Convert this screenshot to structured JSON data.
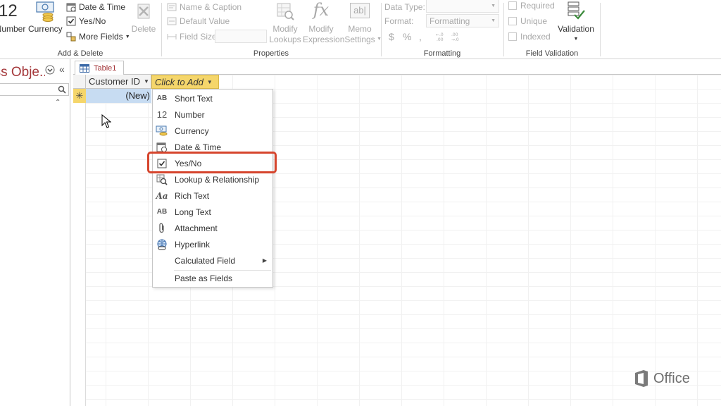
{
  "ribbon": {
    "add_delete": {
      "group_label": "Add & Delete",
      "number_glyph": "12",
      "number_label": "Number",
      "currency_label": "Currency",
      "date_time_label": "Date & Time",
      "yes_no_label": "Yes/No",
      "more_fields_label": "More Fields",
      "delete_label": "Delete"
    },
    "properties": {
      "group_label": "Properties",
      "name_caption_label": "Name & Caption",
      "default_value_label": "Default Value",
      "field_size_label": "Field Size",
      "modify_lookups_label_1": "Modify",
      "modify_lookups_label_2": "Lookups",
      "modify_expression_label_1": "Modify",
      "modify_expression_label_2": "Expression",
      "memo_settings_label_1": "Memo",
      "memo_settings_label_2": "Settings"
    },
    "formatting": {
      "group_label": "Formatting",
      "data_type_label": "Data Type:",
      "format_label": "Format:",
      "format_value": "Formatting",
      "currency_symbol": "$",
      "percent_symbol": "%",
      "comma_symbol": ","
    },
    "field_validation": {
      "group_label": "Field Validation",
      "required_label": "Required",
      "unique_label": "Unique",
      "indexed_label": "Indexed",
      "validation_label": "Validation"
    }
  },
  "nav": {
    "title": "All Access Obje..."
  },
  "document": {
    "tab_label": "Table1",
    "columns": {
      "customer_id": "Customer ID",
      "click_to_add": "Click to Add"
    },
    "new_row_label": "(New)"
  },
  "menu": {
    "items": [
      {
        "label": "Short Text",
        "icon_text": "AB"
      },
      {
        "label": "Number",
        "icon_text": "12"
      },
      {
        "label": "Currency",
        "icon_text": ""
      },
      {
        "label": "Date & Time",
        "icon_text": ""
      },
      {
        "label": "Yes/No",
        "icon_text": ""
      },
      {
        "label": "Lookup & Relationship",
        "icon_text": ""
      },
      {
        "label": "Rich Text",
        "icon_text": "Aa"
      },
      {
        "label": "Long Text",
        "icon_text": "AB"
      },
      {
        "label": "Attachment",
        "icon_text": ""
      },
      {
        "label": "Hyperlink",
        "icon_text": ""
      },
      {
        "label": "Calculated Field",
        "icon_text": ""
      },
      {
        "label": "Paste as Fields",
        "icon_text": ""
      }
    ]
  },
  "branding": {
    "office_label": "Office"
  },
  "colors": {
    "accent": "#a4373a",
    "highlight": "#d6452d",
    "column_header_active": "#f5d66b",
    "new_cell": "#c7dcf2"
  }
}
